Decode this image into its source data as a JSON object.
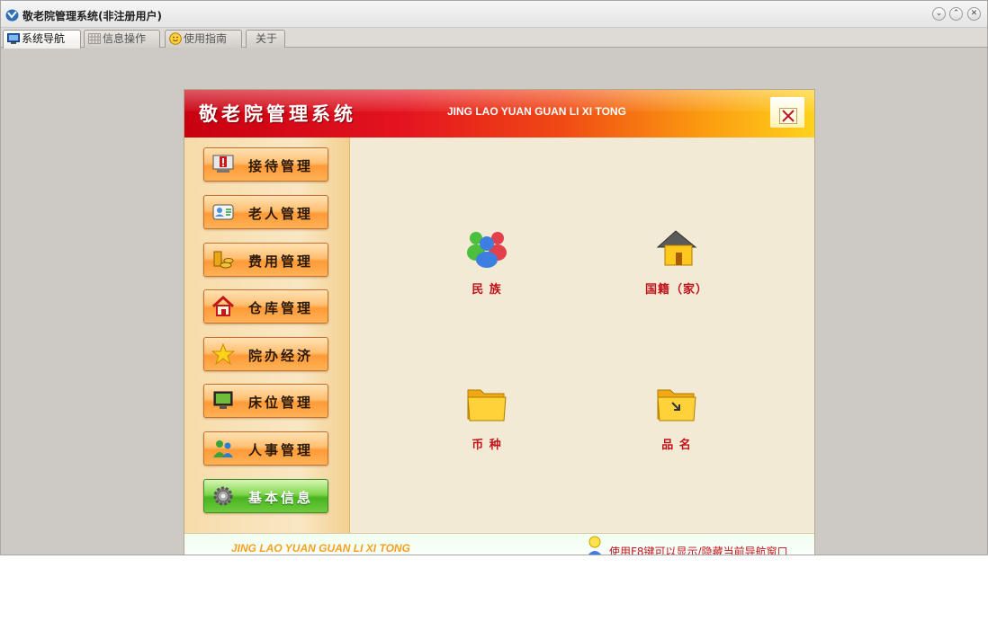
{
  "window": {
    "title": "敬老院管理系统(非注册用户)"
  },
  "title_buttons": {
    "minimize": "⌄",
    "maximize": "⌃",
    "close": "✕"
  },
  "tabs": [
    {
      "label": "系统导航",
      "active": true,
      "icon": "monitor-icon"
    },
    {
      "label": "信息操作",
      "active": false,
      "icon": "grid-icon"
    },
    {
      "label": "使用指南",
      "active": false,
      "icon": "smiley-icon"
    },
    {
      "label": "关于",
      "active": false,
      "icon": ""
    }
  ],
  "nav": {
    "title": "敬老院管理系统",
    "subtitle": "JING LAO YUAN GUAN LI XI TONG",
    "close_icon": "close-icon"
  },
  "sidebar": {
    "items": [
      {
        "label": "接待管理",
        "icon": "alert-monitor-icon"
      },
      {
        "label": "老人管理",
        "icon": "id-card-icon"
      },
      {
        "label": "费用管理",
        "icon": "coins-icon"
      },
      {
        "label": "仓库管理",
        "icon": "house-icon"
      },
      {
        "label": "院办经济",
        "icon": "star-icon"
      },
      {
        "label": "床位管理",
        "icon": "monitor-icon"
      },
      {
        "label": "人事管理",
        "icon": "people-icon"
      },
      {
        "label": "基本信息",
        "icon": "gear-icon"
      }
    ]
  },
  "main": {
    "items": [
      {
        "label": "民 族",
        "icon": "people-group-icon"
      },
      {
        "label": "国籍（家）",
        "icon": "house-icon"
      },
      {
        "label": "币 种",
        "icon": "folder-icon"
      },
      {
        "label": "品 名",
        "icon": "folder-arrow-icon"
      }
    ]
  },
  "footer": {
    "left": "JING LAO YUAN GUAN LI XI TONG",
    "right": "使用F8键可以显示/隐藏当前导航窗口",
    "icon": "lightbulb-person-icon"
  },
  "colors": {
    "window_bg": "#cdc9c4",
    "header_red": "#d5101a",
    "header_yellow": "#ffd21c",
    "label_red": "#c0141c",
    "button_orange": "#ff9a36",
    "button_green": "#47b420"
  }
}
